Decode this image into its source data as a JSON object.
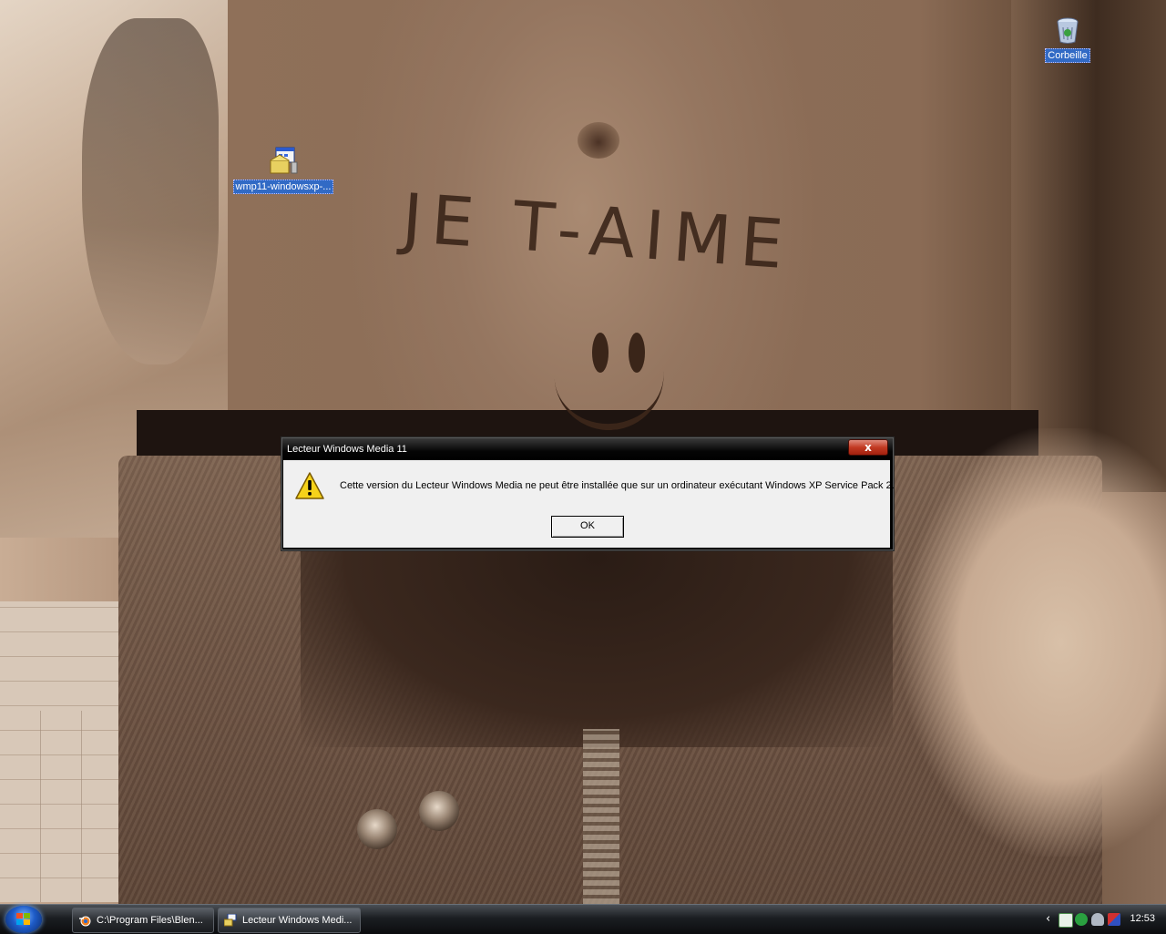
{
  "desktop": {
    "icons": [
      {
        "label": "wmp11-windowsxp-...",
        "icon": "installer-icon"
      },
      {
        "label": "Corbeille",
        "icon": "recycle-bin-icon"
      }
    ],
    "wallpaper": {
      "belly_text": "JE T-AIME"
    }
  },
  "dialog": {
    "title": "Lecteur Windows Media 11",
    "close_label": "x",
    "message": "Cette version du Lecteur Windows Media ne peut être installée que sur un ordinateur exécutant Windows XP Service Pack 2.",
    "ok_label": "OK",
    "icon": "warning-icon"
  },
  "taskbar": {
    "start_icon": "windows-logo-icon",
    "tasks": [
      {
        "label": "C:\\Program Files\\Blen...",
        "icon": "blender-icon"
      },
      {
        "label": "Lecteur Windows Medi...",
        "icon": "installer-icon",
        "active": true
      }
    ],
    "tray": {
      "chevron": "‹",
      "icons": [
        "monitor-icon",
        "network-icon",
        "user-icon",
        "shield-icon"
      ],
      "clock": "12:53"
    }
  },
  "colors": {
    "selection": "#316ac5",
    "dialog_title_bg": "#000000",
    "close_button": "#c23a22",
    "dialog_body": "#f0f0f0",
    "taskbar": "#1b1e22"
  }
}
